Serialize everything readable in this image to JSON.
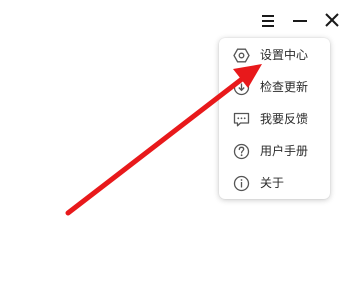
{
  "window_controls": {
    "menu_icon": "hamburger-menu-icon",
    "minimize_icon": "minimize-icon",
    "close_icon": "close-icon"
  },
  "menu": {
    "items": [
      {
        "label": "设置中心",
        "icon": "settings-hexagon-icon"
      },
      {
        "label": "检查更新",
        "icon": "update-check-icon"
      },
      {
        "label": "我要反馈",
        "icon": "feedback-chat-icon"
      },
      {
        "label": "用户手册",
        "icon": "help-question-icon"
      },
      {
        "label": "关于",
        "icon": "info-icon"
      }
    ]
  },
  "annotation": {
    "color": "#e8191b",
    "target": "设置中心"
  },
  "colors": {
    "icon": "#1a1a1a",
    "menu_text": "#2b2b2b",
    "menu_icon": "#555555"
  }
}
